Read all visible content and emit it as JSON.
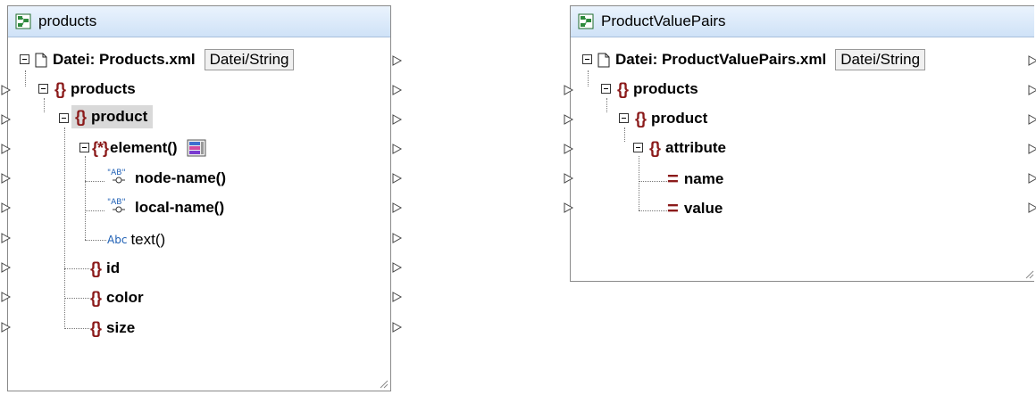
{
  "left": {
    "title": "products",
    "file_label": "Datei: Products.xml",
    "file_button": "Datei/String",
    "nodes": {
      "products": "products",
      "product": "product",
      "element": "element()",
      "node_name": "node-name()",
      "local_name": "local-name()",
      "text": "text()",
      "id": "id",
      "color": "color",
      "size": "size"
    },
    "abc": "Abc",
    "ab": "AB"
  },
  "right": {
    "title": "ProductValuePairs",
    "file_label": "Datei: ProductValuePairs.xml",
    "file_button": "Datei/String",
    "nodes": {
      "products": "products",
      "product": "product",
      "attribute": "attribute",
      "name": "name",
      "value": "value"
    }
  },
  "colors": {
    "brace": "#8b1a1a",
    "title_grad_top": "#eaf3fd",
    "title_grad_bottom": "#cfe2f7",
    "function_blue": "#1e5fb4"
  }
}
